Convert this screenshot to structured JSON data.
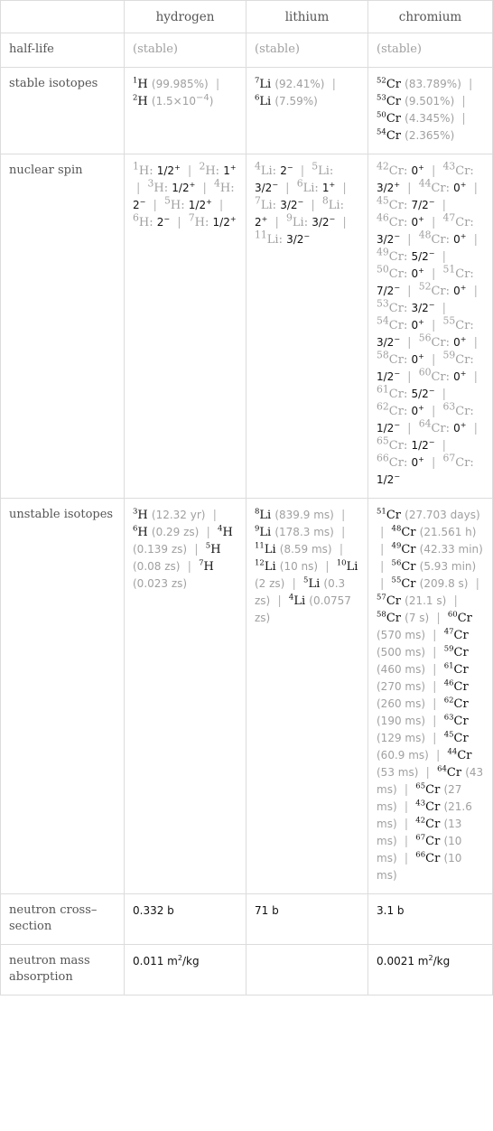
{
  "header": {
    "corner": "",
    "columns": [
      "hydrogen",
      "lithium",
      "chromium"
    ]
  },
  "rows": {
    "half_life": {
      "label": "half-life",
      "values": [
        "(stable)",
        "(stable)",
        "(stable)"
      ]
    },
    "stable_isotopes": {
      "label": "stable isotopes",
      "hydrogen": [
        {
          "mass": "1",
          "symbol": "H",
          "abundance": "(99.985%)"
        },
        {
          "mass": "2",
          "symbol": "H",
          "abundance_base": "(1.5×10",
          "abundance_exp": "−4",
          "abundance_close": ")"
        }
      ],
      "lithium": [
        {
          "mass": "7",
          "symbol": "Li",
          "abundance": "(92.41%)"
        },
        {
          "mass": "6",
          "symbol": "Li",
          "abundance": "(7.59%)"
        }
      ],
      "chromium": [
        {
          "mass": "52",
          "symbol": "Cr",
          "abundance": "(83.789%)"
        },
        {
          "mass": "53",
          "symbol": "Cr",
          "abundance": "(9.501%)"
        },
        {
          "mass": "50",
          "symbol": "Cr",
          "abundance": "(4.345%)"
        },
        {
          "mass": "54",
          "symbol": "Cr",
          "abundance": "(2.365%)"
        }
      ]
    },
    "nuclear_spin": {
      "label": "nuclear spin",
      "hydrogen": [
        {
          "mass": "1",
          "symbol": "H",
          "spin": "1/2",
          "parity": "+"
        },
        {
          "mass": "2",
          "symbol": "H",
          "spin": "1",
          "parity": "+"
        },
        {
          "mass": "3",
          "symbol": "H",
          "spin": "1/2",
          "parity": "+"
        },
        {
          "mass": "4",
          "symbol": "H",
          "spin": "2",
          "parity": "−"
        },
        {
          "mass": "5",
          "symbol": "H",
          "spin": "1/2",
          "parity": "+"
        },
        {
          "mass": "6",
          "symbol": "H",
          "spin": "2",
          "parity": "−"
        },
        {
          "mass": "7",
          "symbol": "H",
          "spin": "1/2",
          "parity": "+"
        }
      ],
      "lithium": [
        {
          "mass": "4",
          "symbol": "Li",
          "spin": "2",
          "parity": "−"
        },
        {
          "mass": "5",
          "symbol": "Li",
          "spin": "3/2",
          "parity": "−"
        },
        {
          "mass": "6",
          "symbol": "Li",
          "spin": "1",
          "parity": "+"
        },
        {
          "mass": "7",
          "symbol": "Li",
          "spin": "3/2",
          "parity": "−"
        },
        {
          "mass": "8",
          "symbol": "Li",
          "spin": "2",
          "parity": "+"
        },
        {
          "mass": "9",
          "symbol": "Li",
          "spin": "3/2",
          "parity": "−"
        },
        {
          "mass": "11",
          "symbol": "Li",
          "spin": "3/2",
          "parity": "−"
        }
      ],
      "chromium": [
        {
          "mass": "42",
          "symbol": "Cr",
          "spin": "0",
          "parity": "+"
        },
        {
          "mass": "43",
          "symbol": "Cr",
          "spin": "3/2",
          "parity": "+"
        },
        {
          "mass": "44",
          "symbol": "Cr",
          "spin": "0",
          "parity": "+"
        },
        {
          "mass": "45",
          "symbol": "Cr",
          "spin": "7/2",
          "parity": "−"
        },
        {
          "mass": "46",
          "symbol": "Cr",
          "spin": "0",
          "parity": "+"
        },
        {
          "mass": "47",
          "symbol": "Cr",
          "spin": "3/2",
          "parity": "−"
        },
        {
          "mass": "48",
          "symbol": "Cr",
          "spin": "0",
          "parity": "+"
        },
        {
          "mass": "49",
          "symbol": "Cr",
          "spin": "5/2",
          "parity": "−"
        },
        {
          "mass": "50",
          "symbol": "Cr",
          "spin": "0",
          "parity": "+"
        },
        {
          "mass": "51",
          "symbol": "Cr",
          "spin": "7/2",
          "parity": "−"
        },
        {
          "mass": "52",
          "symbol": "Cr",
          "spin": "0",
          "parity": "+"
        },
        {
          "mass": "53",
          "symbol": "Cr",
          "spin": "3/2",
          "parity": "−"
        },
        {
          "mass": "54",
          "symbol": "Cr",
          "spin": "0",
          "parity": "+"
        },
        {
          "mass": "55",
          "symbol": "Cr",
          "spin": "3/2",
          "parity": "−"
        },
        {
          "mass": "56",
          "symbol": "Cr",
          "spin": "0",
          "parity": "+"
        },
        {
          "mass": "58",
          "symbol": "Cr",
          "spin": "0",
          "parity": "+"
        },
        {
          "mass": "59",
          "symbol": "Cr",
          "spin": "1/2",
          "parity": "−"
        },
        {
          "mass": "60",
          "symbol": "Cr",
          "spin": "0",
          "parity": "+"
        },
        {
          "mass": "61",
          "symbol": "Cr",
          "spin": "5/2",
          "parity": "−"
        },
        {
          "mass": "62",
          "symbol": "Cr",
          "spin": "0",
          "parity": "+"
        },
        {
          "mass": "63",
          "symbol": "Cr",
          "spin": "1/2",
          "parity": "−"
        },
        {
          "mass": "64",
          "symbol": "Cr",
          "spin": "0",
          "parity": "+"
        },
        {
          "mass": "65",
          "symbol": "Cr",
          "spin": "1/2",
          "parity": "−"
        },
        {
          "mass": "66",
          "symbol": "Cr",
          "spin": "0",
          "parity": "+"
        },
        {
          "mass": "67",
          "symbol": "Cr",
          "spin": "1/2",
          "parity": "−"
        }
      ]
    },
    "unstable_isotopes": {
      "label": "unstable isotopes",
      "hydrogen": [
        {
          "mass": "3",
          "symbol": "H",
          "half_life": "(12.32 yr)"
        },
        {
          "mass": "6",
          "symbol": "H",
          "half_life": "(0.29 zs)"
        },
        {
          "mass": "4",
          "symbol": "H",
          "half_life": "(0.139 zs)"
        },
        {
          "mass": "5",
          "symbol": "H",
          "half_life": "(0.08 zs)"
        },
        {
          "mass": "7",
          "symbol": "H",
          "half_life": "(0.023 zs)"
        }
      ],
      "lithium": [
        {
          "mass": "8",
          "symbol": "Li",
          "half_life": "(839.9 ms)"
        },
        {
          "mass": "9",
          "symbol": "Li",
          "half_life": "(178.3 ms)"
        },
        {
          "mass": "11",
          "symbol": "Li",
          "half_life": "(8.59 ms)"
        },
        {
          "mass": "12",
          "symbol": "Li",
          "half_life": "(10 ns)"
        },
        {
          "mass": "10",
          "symbol": "Li",
          "half_life": "(2 zs)"
        },
        {
          "mass": "5",
          "symbol": "Li",
          "half_life": "(0.3 zs)"
        },
        {
          "mass": "4",
          "symbol": "Li",
          "half_life": "(0.0757 zs)"
        }
      ],
      "chromium": [
        {
          "mass": "51",
          "symbol": "Cr",
          "half_life": "(27.703 days)"
        },
        {
          "mass": "48",
          "symbol": "Cr",
          "half_life": "(21.561 h)"
        },
        {
          "mass": "49",
          "symbol": "Cr",
          "half_life": "(42.33 min)"
        },
        {
          "mass": "56",
          "symbol": "Cr",
          "half_life": "(5.93 min)"
        },
        {
          "mass": "55",
          "symbol": "Cr",
          "half_life": "(209.8 s)"
        },
        {
          "mass": "57",
          "symbol": "Cr",
          "half_life": "(21.1 s)"
        },
        {
          "mass": "58",
          "symbol": "Cr",
          "half_life": "(7 s)"
        },
        {
          "mass": "60",
          "symbol": "Cr",
          "half_life": "(570 ms)"
        },
        {
          "mass": "47",
          "symbol": "Cr",
          "half_life": "(500 ms)"
        },
        {
          "mass": "59",
          "symbol": "Cr",
          "half_life": "(460 ms)"
        },
        {
          "mass": "61",
          "symbol": "Cr",
          "half_life": "(270 ms)"
        },
        {
          "mass": "46",
          "symbol": "Cr",
          "half_life": "(260 ms)"
        },
        {
          "mass": "62",
          "symbol": "Cr",
          "half_life": "(190 ms)"
        },
        {
          "mass": "63",
          "symbol": "Cr",
          "half_life": "(129 ms)"
        },
        {
          "mass": "45",
          "symbol": "Cr",
          "half_life": "(60.9 ms)"
        },
        {
          "mass": "44",
          "symbol": "Cr",
          "half_life": "(53 ms)"
        },
        {
          "mass": "64",
          "symbol": "Cr",
          "half_life": "(43 ms)"
        },
        {
          "mass": "65",
          "symbol": "Cr",
          "half_life": "(27 ms)"
        },
        {
          "mass": "43",
          "symbol": "Cr",
          "half_life": "(21.6 ms)"
        },
        {
          "mass": "42",
          "symbol": "Cr",
          "half_life": "(13 ms)"
        },
        {
          "mass": "67",
          "symbol": "Cr",
          "half_life": "(10 ms)"
        },
        {
          "mass": "66",
          "symbol": "Cr",
          "half_life": "(10 ms)"
        }
      ]
    },
    "neutron_cross_section": {
      "label": "neutron cross–section",
      "values": [
        "0.332 b",
        "71 b",
        "3.1 b"
      ]
    },
    "neutron_mass_absorption": {
      "label": "neutron mass absorption",
      "values": [
        {
          "base": "0.011 m",
          "exp": "2",
          "unit": "/kg"
        },
        null,
        {
          "base": "0.0021 m",
          "exp": "2",
          "unit": "/kg"
        }
      ]
    }
  },
  "separator": "|"
}
